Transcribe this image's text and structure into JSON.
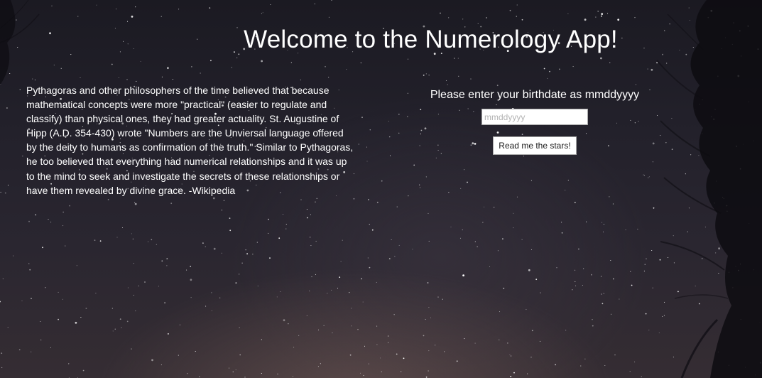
{
  "header": {
    "title": "Welcome to the Numerology App!"
  },
  "intro": {
    "quote": "Pythagoras and other philosophers of the time believed that because mathematical concepts were more \"practical\" (easier to regulate and classify) than physical ones, they had greater actuality. St. Augustine of Hipp (A.D. 354-430) wrote \"Numbers are the Unviersal language offered by the deity to humans as confirmation of the truth.\" Similar to Pythagoras, he too believed that everything had numerical relationships and it was up to the mind to seek and investigate the secrets of these relationships or have them revealed by divine grace. -Wikipedia"
  },
  "form": {
    "prompt": "Please enter your birthdate as mmddyyyy",
    "input_value": "",
    "input_placeholder": "mmddyyyy",
    "submit_label": "Read me the stars!"
  },
  "background": {
    "description_icon": "starry-night-sky",
    "sky_color_top": "#1b1a22",
    "sky_color_bottom": "#352d33"
  }
}
